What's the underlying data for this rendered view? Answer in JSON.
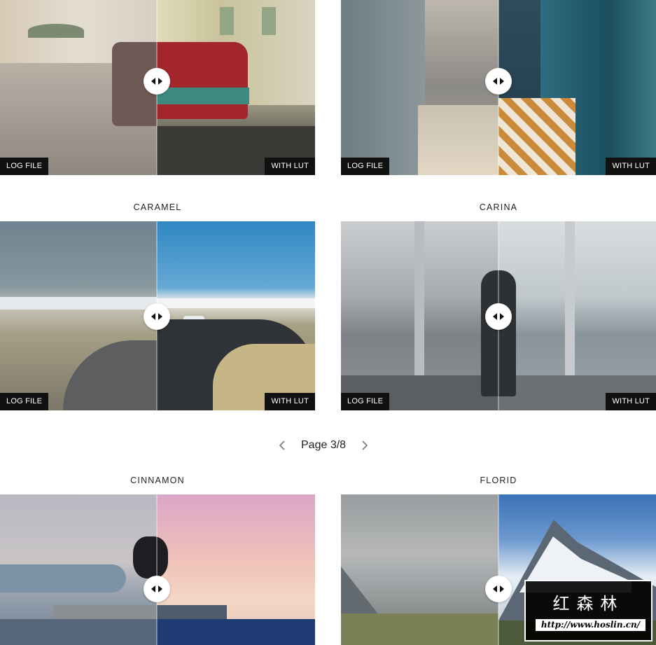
{
  "comparison": {
    "left_tag": "LOG FILE",
    "right_tag": "WITH LUT",
    "handle_icon": "compare-arrows-icon"
  },
  "grid": {
    "row1": [
      {
        "title": ""
      },
      {
        "title": ""
      }
    ],
    "row2": [
      {
        "title": "CARAMEL"
      },
      {
        "title": "CARINA"
      }
    ],
    "row3": [
      {
        "title": "CINNAMON"
      },
      {
        "title": "FLORID"
      }
    ]
  },
  "pagination": {
    "label": "Page 3/8",
    "prev_icon": "chevron-left-icon",
    "next_icon": "chevron-right-icon"
  },
  "watermark": {
    "cn": "红森林",
    "url": "http://www.hoslin.cn/"
  }
}
